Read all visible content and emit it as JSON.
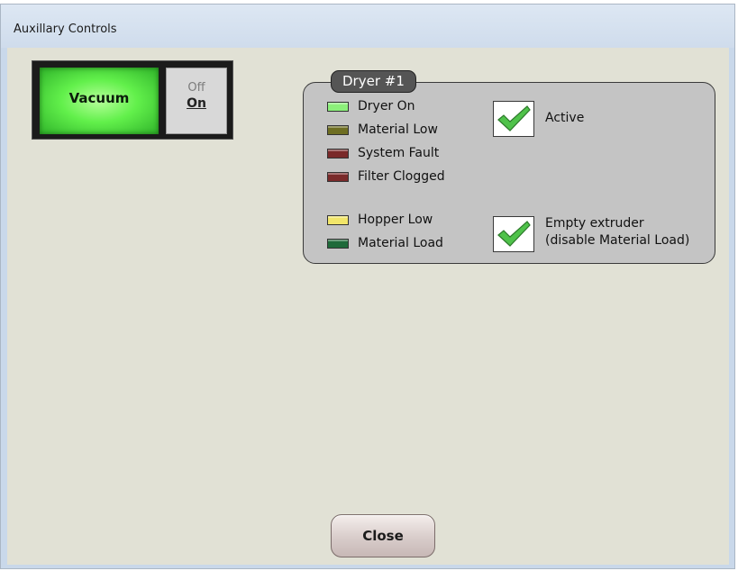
{
  "window": {
    "title": "Auxillary Controls"
  },
  "vacuum": {
    "label": "Vacuum",
    "off_label": "Off",
    "on_label": "On"
  },
  "dryer": {
    "title": "Dryer #1",
    "indicators": [
      {
        "label": "Dryer On",
        "color": "#8cf07a"
      },
      {
        "label": "Material Low",
        "color": "#6e6e22"
      },
      {
        "label": "System Fault",
        "color": "#7a2a2a"
      },
      {
        "label": "Filter Clogged",
        "color": "#7a2a2a"
      },
      {
        "label": "Hopper Low",
        "color": "#f2e66a"
      },
      {
        "label": "Material Load",
        "color": "#1f6a3a"
      }
    ],
    "checkboxes": [
      {
        "label": "Active",
        "checked": true
      },
      {
        "label_line1": "Empty extruder",
        "label_line2": "(disable Material Load)",
        "checked": true
      }
    ]
  },
  "close_button": {
    "label": "Close"
  }
}
